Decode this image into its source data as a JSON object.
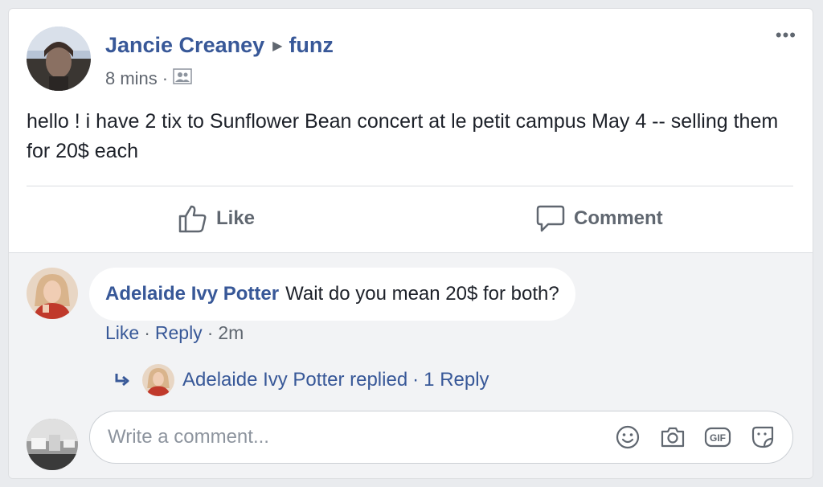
{
  "post": {
    "author": "Jancie Creaney",
    "group": "funz",
    "time": "8 mins",
    "text": "hello ! i have 2 tix to Sunflower Bean concert at le petit campus May 4 -- selling them for 20$ each",
    "audience_icon": "group-icon",
    "more_label": "•••"
  },
  "actions": {
    "like_label": "Like",
    "comment_label": "Comment"
  },
  "comment": {
    "author": "Adelaide Ivy Potter",
    "text": "Wait do you mean 20$ for both?",
    "like_label": "Like",
    "reply_label": "Reply",
    "time": "2m",
    "replies_text": "Adelaide Ivy Potter replied",
    "replies_count": "1 Reply"
  },
  "composer": {
    "placeholder": "Write a comment...",
    "tool_icons": [
      "emoji-icon",
      "camera-icon",
      "gif-icon",
      "sticker-icon"
    ]
  },
  "colors": {
    "link": "#385898",
    "muted": "#606770",
    "comments_bg": "#f2f3f5"
  }
}
